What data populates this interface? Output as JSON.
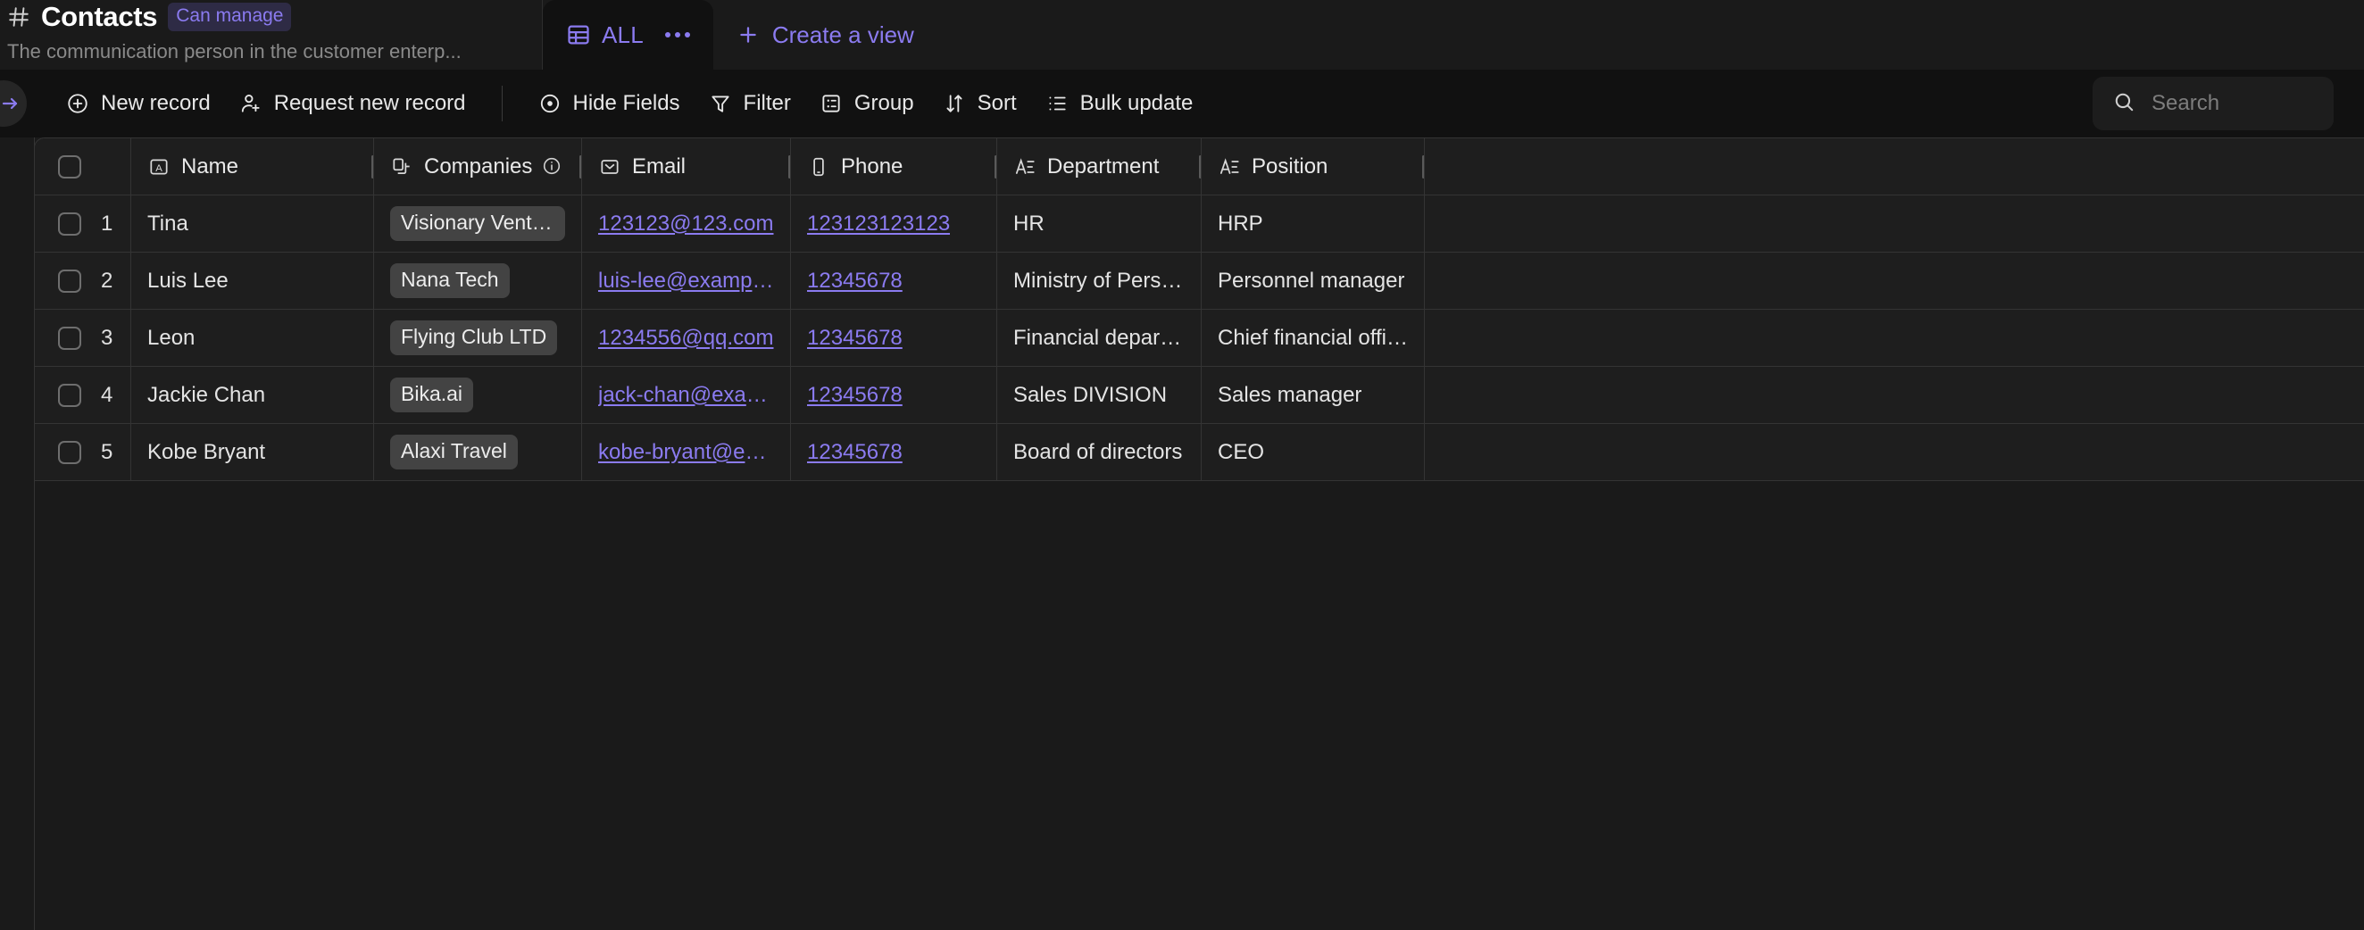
{
  "header": {
    "hash_icon": "hash-icon",
    "title": "Contacts",
    "permission_badge": "Can manage",
    "subtitle": "The communication person in the customer enterp...",
    "tab": {
      "icon": "table-icon",
      "label": "ALL",
      "more_icon": "ellipsis-icon"
    },
    "create_view": {
      "icon": "plus-icon",
      "label": "Create a view"
    }
  },
  "toolbar": {
    "collapse_icon": "arrow-right-icon",
    "items": [
      {
        "icon": "plus-circle-icon",
        "label": "New record"
      },
      {
        "icon": "user-plus-icon",
        "label": "Request new record"
      },
      {
        "icon": "eye-icon",
        "label": "Hide Fields"
      },
      {
        "icon": "funnel-icon",
        "label": "Filter"
      },
      {
        "icon": "group-icon",
        "label": "Group"
      },
      {
        "icon": "sort-icon",
        "label": "Sort"
      },
      {
        "icon": "list-check-icon",
        "label": "Bulk update"
      }
    ],
    "search": {
      "icon": "search-icon",
      "value": "",
      "placeholder": "Search"
    }
  },
  "table": {
    "select_all_checkbox": false,
    "columns": [
      {
        "key": "name",
        "label": "Name",
        "icon": "text-field-icon"
      },
      {
        "key": "companies",
        "label": "Companies",
        "icon": "link-record-icon",
        "info_icon": "info-icon"
      },
      {
        "key": "email",
        "label": "Email",
        "icon": "email-icon"
      },
      {
        "key": "phone",
        "label": "Phone",
        "icon": "phone-icon"
      },
      {
        "key": "department",
        "label": "Department",
        "icon": "long-text-icon"
      },
      {
        "key": "position",
        "label": "Position",
        "icon": "long-text-icon"
      }
    ],
    "rows": [
      {
        "num": "1",
        "name": "Tina",
        "companies": "Visionary Ventures",
        "email": "123123@123.com",
        "phone": "123123123123",
        "department": "HR",
        "position": "HRP"
      },
      {
        "num": "2",
        "name": "Luis Lee",
        "companies": "Nana Tech",
        "email": "luis-lee@example.com",
        "phone": "12345678",
        "department": "Ministry of Personnel",
        "position": "Personnel manager"
      },
      {
        "num": "3",
        "name": "Leon",
        "companies": "Flying Club LTD",
        "email": "1234556@qq.com",
        "phone": "12345678",
        "department": "Financial department",
        "position": "Chief financial officer"
      },
      {
        "num": "4",
        "name": "Jackie Chan",
        "companies": "Bika.ai",
        "email": "jack-chan@example.com",
        "phone": "12345678",
        "department": "Sales DIVISION",
        "position": "Sales manager"
      },
      {
        "num": "5",
        "name": "Kobe Bryant",
        "companies": "Alaxi Travel",
        "email": "kobe-bryant@example.c...",
        "phone": "12345678",
        "department": "Board of directors",
        "position": "CEO"
      }
    ]
  },
  "colors": {
    "accent": "#8b7bf0",
    "canvas": "#1a1a1a",
    "panel": "#111111",
    "row": "#1e1e1e",
    "border": "#343434",
    "tag": "#434343"
  }
}
